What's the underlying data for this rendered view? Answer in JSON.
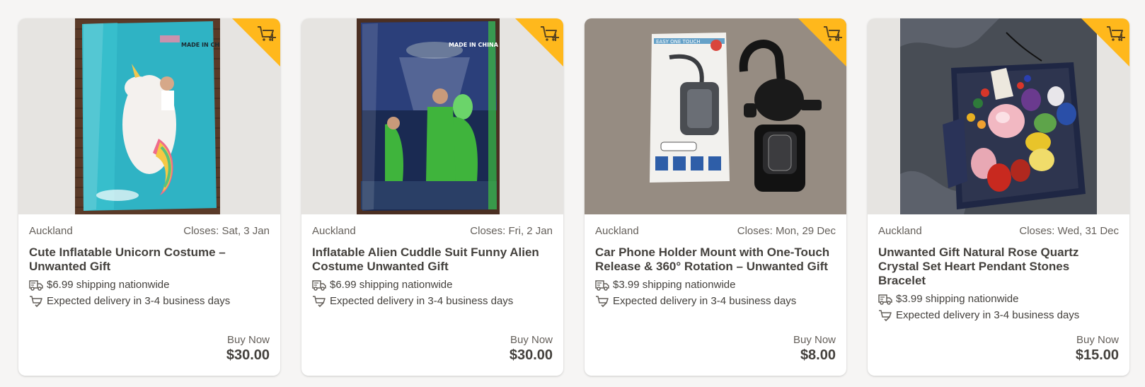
{
  "listings": [
    {
      "location": "Auckland",
      "closes": "Closes: Sat, 3 Jan",
      "title": "Cute Inflatable Unicorn Costume – Unwanted Gift",
      "shipping": "$6.99 shipping nationwide",
      "delivery": "Expected delivery in 3-4 business days",
      "price_label": "Buy Now",
      "price": "$30.00"
    },
    {
      "location": "Auckland",
      "closes": "Closes: Fri, 2 Jan",
      "title": "Inflatable Alien Cuddle Suit Funny Alien Costume Unwanted Gift",
      "shipping": "$6.99 shipping nationwide",
      "delivery": "Expected delivery in 3-4 business days",
      "price_label": "Buy Now",
      "price": "$30.00"
    },
    {
      "location": "Auckland",
      "closes": "Closes: Mon, 29 Dec",
      "title": "Car Phone Holder Mount with One-Touch Release & 360° Rotation – Unwanted Gift",
      "shipping": "$3.99 shipping nationwide",
      "delivery": "Expected delivery in 3-4 business days",
      "price_label": "Buy Now",
      "price": "$8.00"
    },
    {
      "location": "Auckland",
      "closes": "Closes: Wed, 31 Dec",
      "title": "Unwanted Gift Natural Rose Quartz Crystal Set Heart Pendant Stones Bracelet",
      "shipping": "$3.99 shipping nationwide",
      "delivery": "Expected delivery in 3-4 business days",
      "price_label": "Buy Now",
      "price": "$15.00"
    }
  ],
  "image_text": {
    "made_in_china": "MADE IN CHINA",
    "bracket_box": "EASY ONE TOUCH"
  },
  "icons": {
    "ribbon": "add-to-cart-icon",
    "shipping": "delivery-truck-icon",
    "delivery": "cart-check-icon"
  },
  "colors": {
    "ribbon": "#ffb81c",
    "text": "#44413d",
    "muted": "#65605b",
    "background": "#f6f5f4"
  }
}
